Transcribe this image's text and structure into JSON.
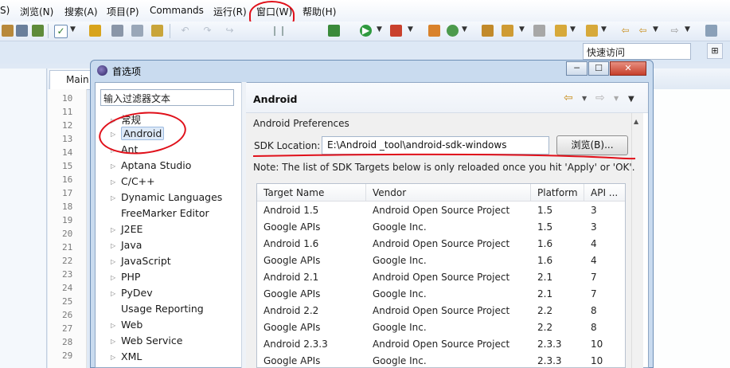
{
  "menubar": {
    "items": [
      "S)",
      "浏览(N)",
      "搜索(A)",
      "项目(P)",
      "Commands",
      "运行(R)",
      "窗口(W)",
      "帮助(H)"
    ]
  },
  "toolbar": {
    "quick_access_placeholder": "快速访问"
  },
  "editor": {
    "tab_label": "Main",
    "line_numbers": [
      "10",
      "11",
      "12",
      "13",
      "14",
      "15",
      "16",
      "17",
      "18",
      "19",
      "20",
      "21",
      "22",
      "23",
      "24",
      "25",
      "26",
      "27",
      "28",
      "29"
    ]
  },
  "dialog": {
    "title": "首选项",
    "window_buttons": {
      "minimize": "─",
      "maximize": "☐",
      "close": "✕"
    },
    "filter_placeholder": "输入过滤器文本",
    "tree_items": [
      {
        "label": "常规",
        "expandable": true
      },
      {
        "label": "Android",
        "expandable": true,
        "selected": true
      },
      {
        "label": "Ant",
        "expandable": true
      },
      {
        "label": "Aptana Studio",
        "expandable": true
      },
      {
        "label": "C/C++",
        "expandable": true
      },
      {
        "label": "Dynamic Languages",
        "expandable": true
      },
      {
        "label": "FreeMarker Editor",
        "expandable": false
      },
      {
        "label": "J2EE",
        "expandable": true
      },
      {
        "label": "Java",
        "expandable": true
      },
      {
        "label": "JavaScript",
        "expandable": true
      },
      {
        "label": "PHP",
        "expandable": true
      },
      {
        "label": "PyDev",
        "expandable": true
      },
      {
        "label": "Usage Reporting",
        "expandable": false
      },
      {
        "label": "Web",
        "expandable": true
      },
      {
        "label": "Web Service",
        "expandable": true
      },
      {
        "label": "XML",
        "expandable": true
      }
    ],
    "page": {
      "title": "Android",
      "heading": "Android Preferences",
      "sdk_label": "SDK Location:",
      "sdk_value": "E:\\Android _tool\\android-sdk-windows",
      "browse_label": "浏览(B)...",
      "note": "Note: The list of SDK Targets below is only reloaded once you hit 'Apply' or 'OK'.",
      "table": {
        "columns": [
          "Target Name",
          "Vendor",
          "Platform",
          "API ..."
        ],
        "rows": [
          [
            "Android 1.5",
            "Android Open Source Project",
            "1.5",
            "3"
          ],
          [
            "Google APIs",
            "Google Inc.",
            "1.5",
            "3"
          ],
          [
            "Android 1.6",
            "Android Open Source Project",
            "1.6",
            "4"
          ],
          [
            "Google APIs",
            "Google Inc.",
            "1.6",
            "4"
          ],
          [
            "Android 2.1",
            "Android Open Source Project",
            "2.1",
            "7"
          ],
          [
            "Google APIs",
            "Google Inc.",
            "2.1",
            "7"
          ],
          [
            "Android 2.2",
            "Android Open Source Project",
            "2.2",
            "8"
          ],
          [
            "Google APIs",
            "Google Inc.",
            "2.2",
            "8"
          ],
          [
            "Android 2.3.3",
            "Android Open Source Project",
            "2.3.3",
            "10"
          ],
          [
            "Google APIs",
            "Google Inc.",
            "2.3.3",
            "10"
          ]
        ]
      }
    }
  },
  "colors": {
    "annotation_red": "#e0101a",
    "selection_bg": "#dde9f8",
    "nav_arrow": "#c98f1e"
  }
}
